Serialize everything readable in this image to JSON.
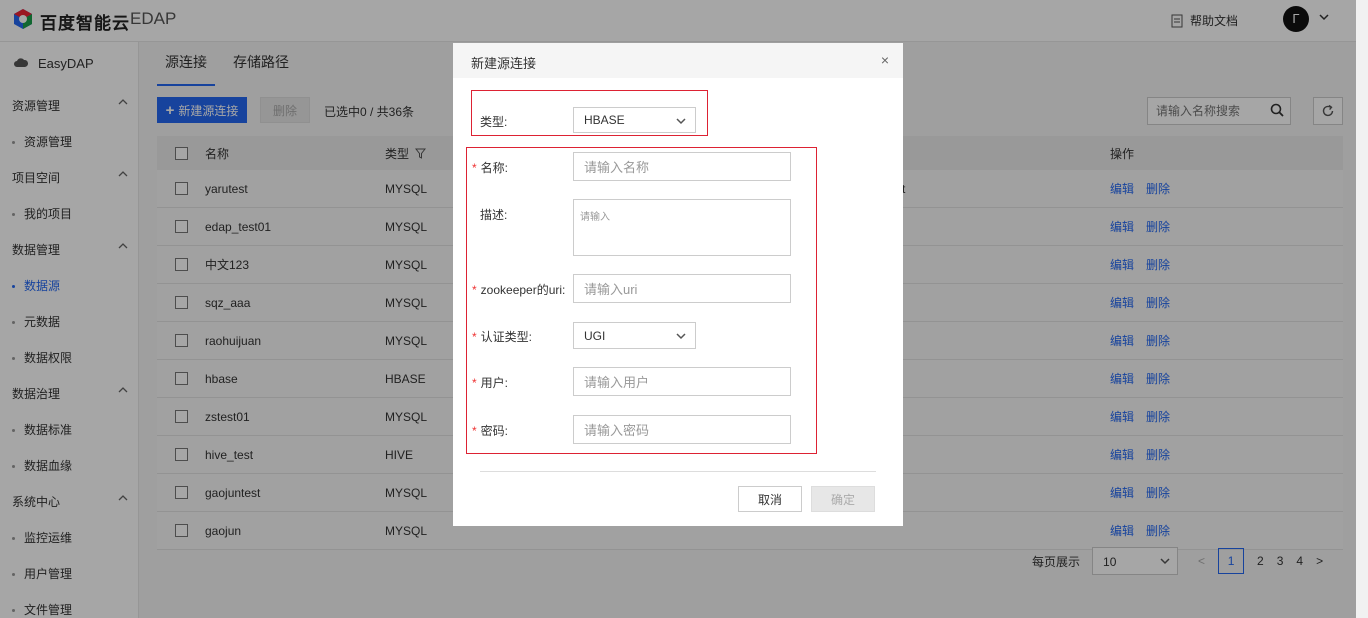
{
  "header": {
    "logo_text": "百度智能云",
    "product": "EDAP",
    "help_label": "帮助文档",
    "avatar_letter": "Γ"
  },
  "sidebar": {
    "brand": "EasyDAP",
    "groups": [
      {
        "label": "资源管理",
        "items": [
          "资源管理"
        ]
      },
      {
        "label": "项目空间",
        "items": [
          "我的项目"
        ]
      },
      {
        "label": "数据管理",
        "items": [
          "数据源",
          "元数据",
          "数据权限"
        ]
      },
      {
        "label": "数据治理",
        "items": [
          "数据标准",
          "数据血缘"
        ]
      },
      {
        "label": "系统中心",
        "items": [
          "监控运维",
          "用户管理",
          "文件管理"
        ]
      }
    ],
    "active_item": "数据源"
  },
  "main": {
    "tabs": [
      "源连接",
      "存储路径"
    ],
    "active_tab": "源连接",
    "new_button": "新建源连接",
    "delete_button": "删除",
    "selected_info": "已选中0 / 共36条",
    "search_placeholder": "请输入名称搜索",
    "table": {
      "headers": {
        "name": "名称",
        "type": "类型",
        "ops": "操作"
      },
      "partial_text_row0": "t",
      "rows": [
        {
          "name": "yarutest",
          "type": "MYSQL"
        },
        {
          "name": "edap_test01",
          "type": "MYSQL"
        },
        {
          "name": "中文123",
          "type": "MYSQL"
        },
        {
          "name": "sqz_aaa",
          "type": "MYSQL"
        },
        {
          "name": "raohuijuan",
          "type": "MYSQL"
        },
        {
          "name": "hbase",
          "type": "HBASE"
        },
        {
          "name": "zstest01",
          "type": "MYSQL"
        },
        {
          "name": "hive_test",
          "type": "HIVE"
        },
        {
          "name": "gaojuntest",
          "type": "MYSQL"
        },
        {
          "name": "gaojun",
          "type": "MYSQL"
        }
      ],
      "edit_label": "编辑",
      "remove_label": "删除"
    },
    "pagination": {
      "per_page_label": "每页展示",
      "page_size": "10",
      "prev": "<",
      "next": ">",
      "pages": [
        "1",
        "2",
        "3",
        "4"
      ],
      "current": "1"
    }
  },
  "modal": {
    "title": "新建源连接",
    "close": "×",
    "type_label": "类型:",
    "type_value": "HBASE",
    "name_label": "名称:",
    "name_placeholder": "请输入名称",
    "desc_label": "描述:",
    "desc_placeholder": "请输入",
    "zk_label": "zookeeper的uri:",
    "zk_placeholder": "请输入uri",
    "auth_label": "认证类型:",
    "auth_value": "UGI",
    "user_label": "用户:",
    "user_placeholder": "请输入用户",
    "pwd_label": "密码:",
    "pwd_placeholder": "请输入密码",
    "cancel": "取消",
    "ok": "确定",
    "required_mark": "*"
  },
  "colors": {
    "accent": "#2468f2",
    "highlight": "#dd2233"
  }
}
